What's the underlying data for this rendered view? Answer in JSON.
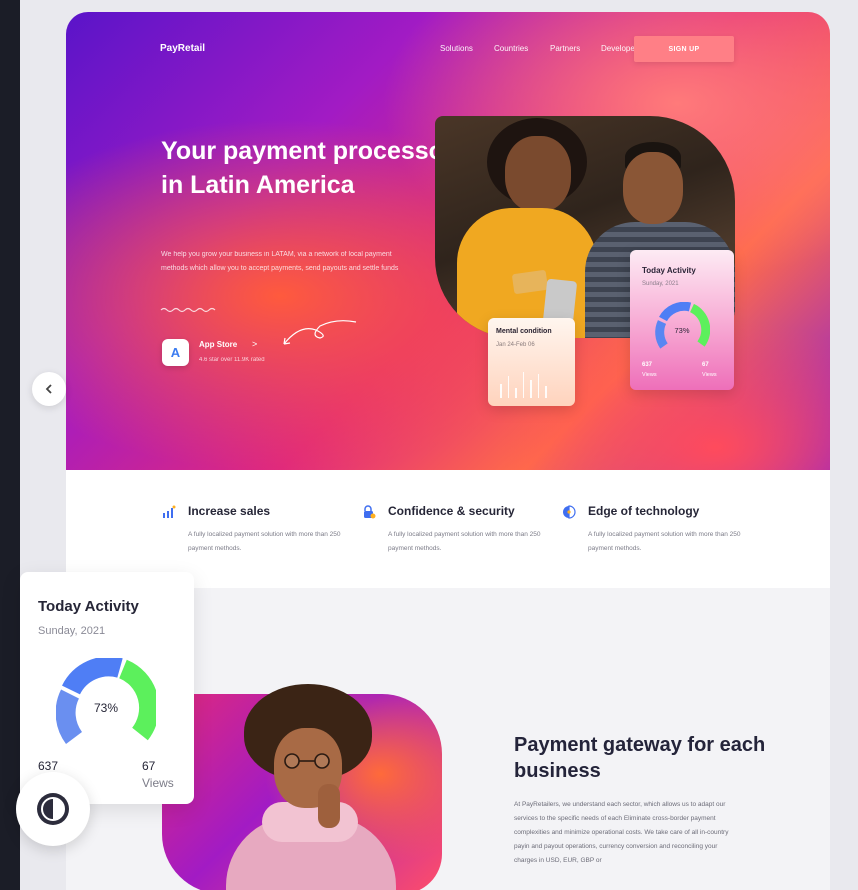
{
  "brand": "PayRetail",
  "nav": {
    "items": [
      "Solutions",
      "Countries",
      "Partners",
      "Developers"
    ],
    "signup_label": "SIGN UP"
  },
  "hero": {
    "headline": "Your payment processor in Latin America",
    "subtext": "We help you grow your business in LATAM, via a network of local payment methods which allow you to accept payments, send payouts and settle funds",
    "store_title": "App Store",
    "store_arrow": ">",
    "store_rating": "4.6 star over 11.9K rated"
  },
  "mental_card": {
    "title": "Mental condition",
    "date": "Jan 24-Feb 06",
    "bars": [
      14,
      22,
      10,
      26,
      18,
      24,
      12
    ]
  },
  "activity_small": {
    "title": "Today Activity",
    "date": "Sunday, 2021",
    "percent": "73%",
    "value_left": "637",
    "label_left": "Views",
    "value_right": "67",
    "label_right": "Views"
  },
  "features": [
    {
      "title": "Increase sales",
      "desc": "A fully localized payment solution with more than 250 payment methods.",
      "icon": "chart-icon"
    },
    {
      "title": "Confidence & security",
      "desc": "A fully localized payment solution with more than 250 payment methods.",
      "icon": "lock-icon"
    },
    {
      "title": "Edge of technology",
      "desc": "A fully localized payment solution with more than 250 payment methods.",
      "icon": "chip-icon"
    }
  ],
  "activity_big": {
    "title": "Today Activity",
    "date": "Sunday, 2021",
    "percent": "73%",
    "value_left": "637",
    "value_right": "67",
    "label_right": "Views"
  },
  "gateway": {
    "title": "Payment gateway for each business",
    "text": "At PayRetailers, we understand each sector, which allows us to adapt our services to the specific needs of each Eliminate cross-border payment complexities and minimize operational costs. We take care of all in-country payin and payout operations, currency conversion and reconciling your charges in USD, EUR, GBP or"
  },
  "colors": {
    "accent": "#ff7f86",
    "donut_blue": "#5a86f2",
    "donut_green": "#5cf05c",
    "dark": "#262637"
  },
  "icons": {
    "prev": "chevron-left-icon",
    "theme": "contrast-icon"
  }
}
